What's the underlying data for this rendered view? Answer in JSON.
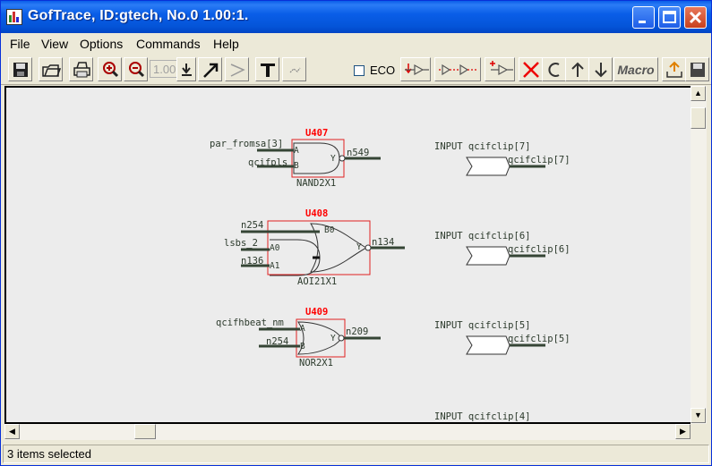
{
  "window": {
    "title": "GofTrace, ID:gtech, No.0 1.00:1."
  },
  "menu": [
    "File",
    "View",
    "Options",
    "Commands",
    "Help"
  ],
  "toolbar": {
    "zoom_value": "1.00",
    "eco_label": "ECO",
    "macro_label": "Macro",
    "icons": [
      "save-icon",
      "open-icon",
      "print-icon",
      "zoom-in-icon",
      "zoom-out-icon",
      "zoom-select-icon",
      "pointer-icon",
      "wire-icon",
      "text-icon",
      "undo-icon",
      "insert-buffer-icon",
      "insert-chain-icon",
      "add-gate-icon",
      "delete-icon",
      "clear-icon",
      "move-up-icon",
      "move-down-icon",
      "export-icon",
      "save-layout-icon"
    ]
  },
  "schematic": {
    "colors": {
      "instance": "#ff0000",
      "wire": "#354535",
      "text": "#2c3a2c",
      "box": "#e02020"
    },
    "gates": [
      {
        "instance": "U407",
        "cell": "NAND2X1",
        "pins_in": [
          "A",
          "B"
        ],
        "pin_out": "Y",
        "nets_in": [
          "par_fromsa[3]",
          "qcifpls"
        ],
        "net_out": "n549"
      },
      {
        "instance": "U408",
        "cell": "AOI21X1",
        "pins_in": [
          "B0",
          "A0",
          "A1"
        ],
        "pin_out": "Y",
        "nets_in": [
          "n254",
          "lsbs_2",
          "n136"
        ],
        "net_out": "n134"
      },
      {
        "instance": "U409",
        "cell": "NOR2X1",
        "pins_in": [
          "A",
          "B"
        ],
        "pin_out": "Y",
        "nets_in": [
          "qcifhbeat_nm",
          "n254"
        ],
        "net_out": "n209"
      }
    ],
    "ports": [
      {
        "label": "INPUT qcifclip[7]",
        "net": "qcifclip[7]"
      },
      {
        "label": "INPUT qcifclip[6]",
        "net": "qcifclip[6]"
      },
      {
        "label": "INPUT qcifclip[5]",
        "net": "qcifclip[5]"
      },
      {
        "label": "INPUT qcifclip[4]",
        "net": ""
      }
    ]
  },
  "status": {
    "text": "3 items selected"
  }
}
